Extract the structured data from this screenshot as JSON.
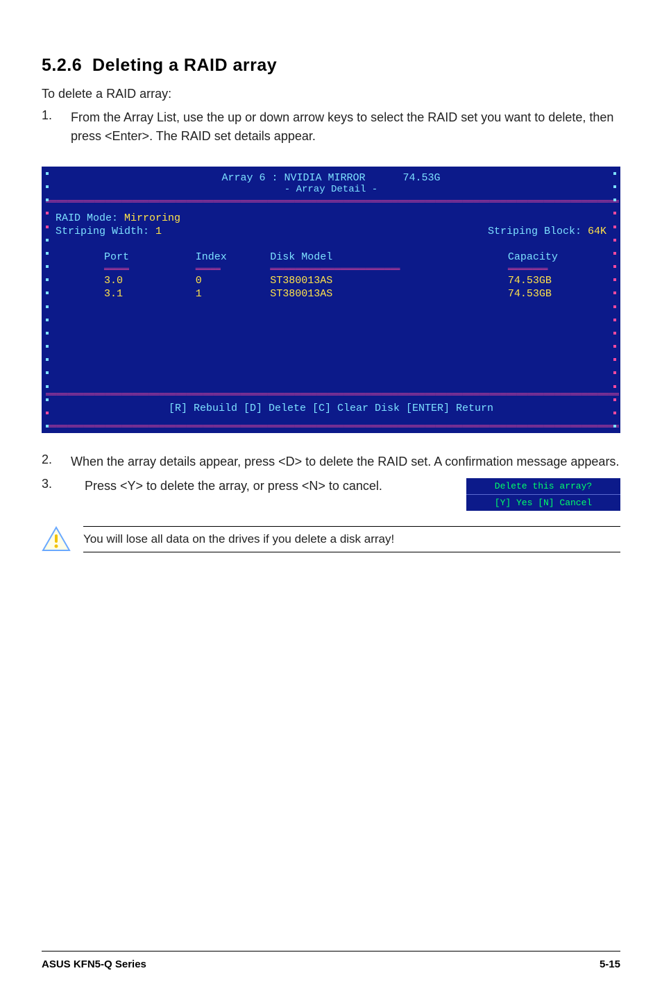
{
  "section": {
    "number": "5.2.6",
    "title": "Deleting a RAID array"
  },
  "intro": "To delete a RAID array:",
  "steps": {
    "s1": {
      "num": "1.",
      "text": "From the Array List, use the up or down arrow keys to select the RAID set you want to delete, then press <Enter>. The RAID set details appear."
    },
    "s2": {
      "num": "2.",
      "text": "When the array details appear, press <D> to delete the RAID set. A confirmation message appears."
    },
    "s3": {
      "num": "3.",
      "text": "Press <Y> to delete the array, or press <N> to cancel."
    }
  },
  "bios": {
    "header": {
      "title": "Array 6 : NVIDIA  MIRROR",
      "size": "74.53G",
      "sub": "- Array Detail -"
    },
    "info": {
      "modeLabel": "RAID Mode: ",
      "modeValue": "Mirroring",
      "widthLabel": "Striping Width: ",
      "widthValue": "1",
      "blockLabel": "Striping Block: ",
      "blockValue": "64K"
    },
    "cols": {
      "port": "Port",
      "index": "Index",
      "model": "Disk Model",
      "cap": "Capacity"
    },
    "rows": [
      {
        "port": "3.0",
        "index": "0",
        "model": "ST380013AS",
        "cap": "74.53GB"
      },
      {
        "port": "3.1",
        "index": "1",
        "model": "ST380013AS",
        "cap": "74.53GB"
      }
    ],
    "footer": "[R] Rebuild  [D] Delete  [C] Clear Disk  [ENTER] Return"
  },
  "confirm": {
    "line1": "Delete this array?",
    "line2": "[Y] Yes   [N] Cancel"
  },
  "warning": "You will lose all data on the drives if you delete a disk array!",
  "footer": {
    "left": "ASUS KFN5-Q Series",
    "right": "5-15"
  }
}
